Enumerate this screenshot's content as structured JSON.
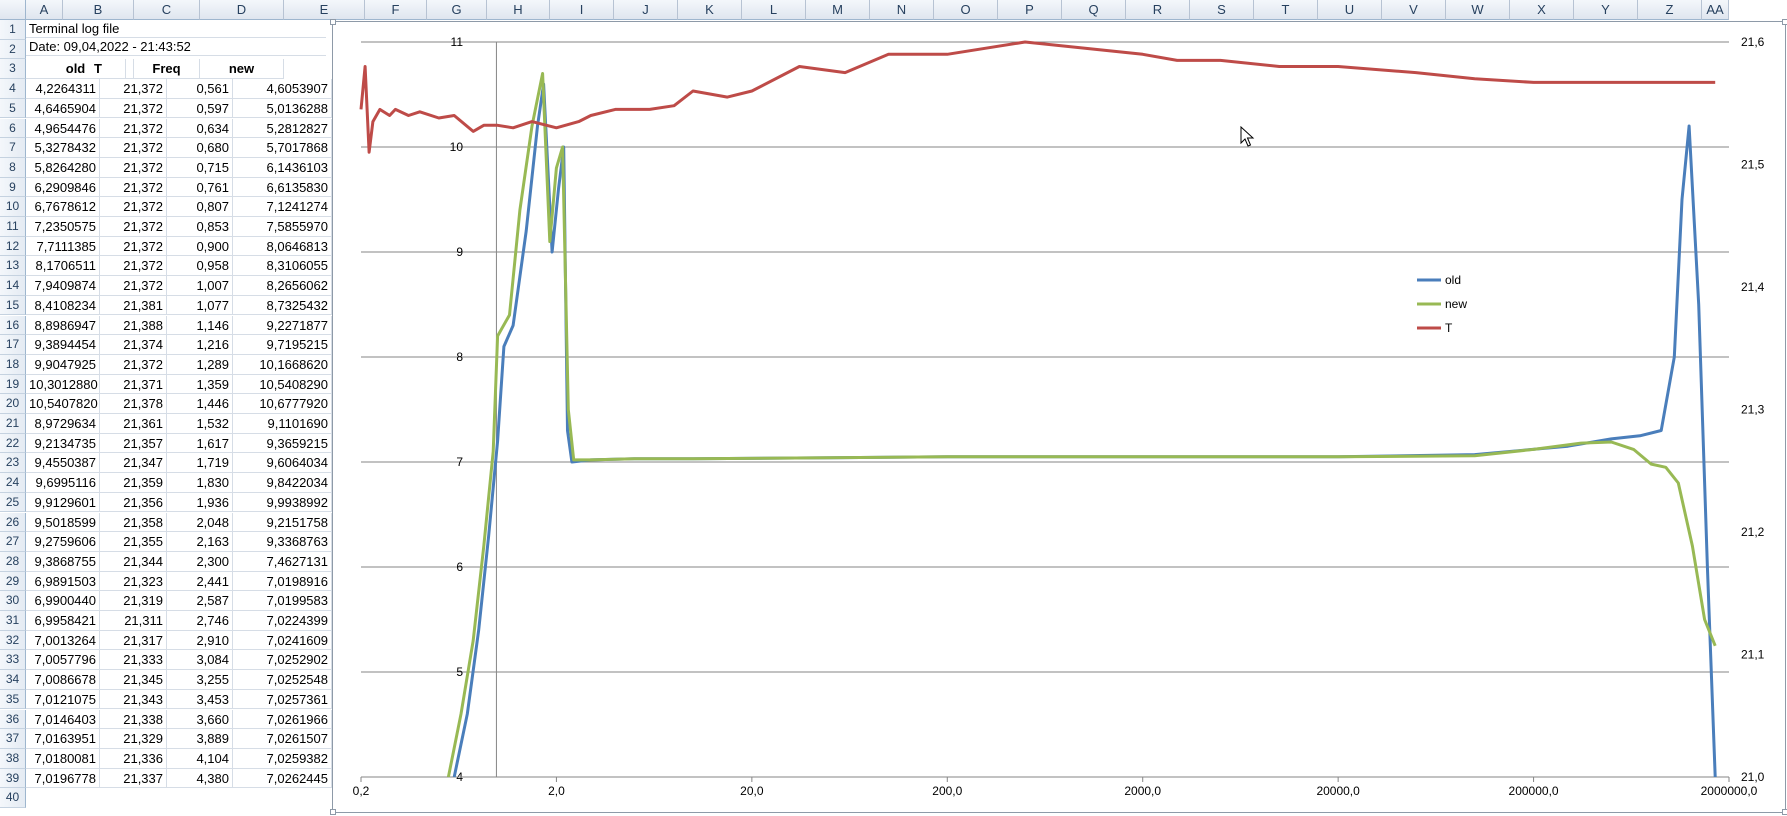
{
  "columns": [
    "A",
    "B",
    "C",
    "D",
    "E",
    "F",
    "G",
    "H",
    "I",
    "J",
    "K",
    "L",
    "M",
    "N",
    "O",
    "P",
    "Q",
    "R",
    "S",
    "T",
    "U",
    "V",
    "W",
    "X",
    "Y",
    "Z",
    "AA"
  ],
  "rows": {
    "r1": "Terminal log file",
    "r2": "Date: 09,04,2022 - 21:43:52",
    "headers": [
      "old",
      "T",
      "Freq",
      "new"
    ],
    "data": [
      [
        "4,2264311",
        "21,372",
        "0,561",
        "4,6053907"
      ],
      [
        "4,6465904",
        "21,372",
        "0,597",
        "5,0136288"
      ],
      [
        "4,9654476",
        "21,372",
        "0,634",
        "5,2812827"
      ],
      [
        "5,3278432",
        "21,372",
        "0,680",
        "5,7017868"
      ],
      [
        "5,8264280",
        "21,372",
        "0,715",
        "6,1436103"
      ],
      [
        "6,2909846",
        "21,372",
        "0,761",
        "6,6135830"
      ],
      [
        "6,7678612",
        "21,372",
        "0,807",
        "7,1241274"
      ],
      [
        "7,2350575",
        "21,372",
        "0,853",
        "7,5855970"
      ],
      [
        "7,7111385",
        "21,372",
        "0,900",
        "8,0646813"
      ],
      [
        "8,1706511",
        "21,372",
        "0,958",
        "8,3106055"
      ],
      [
        "7,9409874",
        "21,372",
        "1,007",
        "8,2656062"
      ],
      [
        "8,4108234",
        "21,381",
        "1,077",
        "8,7325432"
      ],
      [
        "8,8986947",
        "21,388",
        "1,146",
        "9,2271877"
      ],
      [
        "9,3894454",
        "21,374",
        "1,216",
        "9,7195215"
      ],
      [
        "9,9047925",
        "21,372",
        "1,289",
        "10,1668620"
      ],
      [
        "10,3012880",
        "21,371",
        "1,359",
        "10,5408290"
      ],
      [
        "10,5407820",
        "21,378",
        "1,446",
        "10,6777920"
      ],
      [
        "8,9729634",
        "21,361",
        "1,532",
        "9,1101690"
      ],
      [
        "9,2134735",
        "21,357",
        "1,617",
        "9,3659215"
      ],
      [
        "9,4550387",
        "21,347",
        "1,719",
        "9,6064034"
      ],
      [
        "9,6995116",
        "21,359",
        "1,830",
        "9,8422034"
      ],
      [
        "9,9129601",
        "21,356",
        "1,936",
        "9,9938992"
      ],
      [
        "9,5018599",
        "21,358",
        "2,048",
        "9,2151758"
      ],
      [
        "9,2759606",
        "21,355",
        "2,163",
        "9,3368763"
      ],
      [
        "9,3868755",
        "21,344",
        "2,300",
        "7,4627131"
      ],
      [
        "6,9891503",
        "21,323",
        "2,441",
        "7,0198916"
      ],
      [
        "6,9900440",
        "21,319",
        "2,587",
        "7,0199583"
      ],
      [
        "6,9958421",
        "21,311",
        "2,746",
        "7,0224399"
      ],
      [
        "7,0013264",
        "21,317",
        "2,910",
        "7,0241609"
      ],
      [
        "7,0057796",
        "21,333",
        "3,084",
        "7,0252902"
      ],
      [
        "7,0086678",
        "21,345",
        "3,255",
        "7,0252548"
      ],
      [
        "7,0121075",
        "21,343",
        "3,453",
        "7,0257361"
      ],
      [
        "7,0146403",
        "21,338",
        "3,660",
        "7,0261966"
      ],
      [
        "7,0163951",
        "21,329",
        "3,889",
        "7,0261507"
      ],
      [
        "7,0180081",
        "21,336",
        "4,104",
        "7,0259382"
      ],
      [
        "7,0196778",
        "21,337",
        "4,380",
        "7,0262445"
      ]
    ]
  },
  "colors": {
    "old": "#4a7ebb",
    "new": "#98b954",
    "T": "#be4b48"
  },
  "chart_data": {
    "type": "line",
    "x_scale": "log",
    "x_ticks": [
      "0,2",
      "2,0",
      "20,0",
      "200,0",
      "2000,0",
      "20000,0",
      "200000,0",
      "2000000,0"
    ],
    "x_tick_values": [
      0.2,
      2,
      20,
      200,
      2000,
      20000,
      200000,
      2000000
    ],
    "xlim": [
      0.2,
      2000000
    ],
    "y_left_ticks": [
      "4",
      "5",
      "6",
      "7",
      "8",
      "9",
      "10",
      "11"
    ],
    "ylim_left": [
      4,
      11
    ],
    "y_right_ticks": [
      "21,0",
      "21,1",
      "21,2",
      "21,3",
      "21,4",
      "21,5",
      "21,6"
    ],
    "ylim_right": [
      21.0,
      21.6
    ],
    "grid": true,
    "legend_placement": "right",
    "series": [
      {
        "name": "old",
        "axis": "left",
        "x": [
          0.6,
          0.7,
          0.8,
          0.9,
          1.0,
          1.077,
          1.2,
          1.4,
          1.6,
          1.72,
          1.9,
          2.05,
          2.18,
          2.28,
          2.4,
          3,
          5,
          10,
          50,
          200,
          1000,
          5000,
          20000,
          100000,
          300000,
          500000,
          700000,
          900000,
          1050000,
          1150000,
          1250000,
          1400000,
          1550000,
          1700000
        ],
        "y": [
          4.0,
          4.6,
          5.4,
          6.3,
          7.2,
          8.1,
          8.3,
          9.2,
          10.2,
          10.6,
          9.0,
          9.6,
          10.0,
          7.3,
          7.0,
          7.02,
          7.03,
          7.03,
          7.04,
          7.05,
          7.05,
          7.05,
          7.05,
          7.07,
          7.15,
          7.22,
          7.25,
          7.3,
          8.0,
          9.5,
          10.2,
          8.5,
          6.0,
          4.0
        ]
      },
      {
        "name": "new",
        "axis": "left",
        "x": [
          0.56,
          0.65,
          0.75,
          0.85,
          0.95,
          1.0,
          1.15,
          1.3,
          1.5,
          1.7,
          1.85,
          2.0,
          2.15,
          2.3,
          2.45,
          3,
          5,
          10,
          50,
          200,
          1000,
          5000,
          20000,
          100000,
          200000,
          350000,
          500000,
          650000,
          800000,
          950000,
          1100000,
          1300000,
          1500000,
          1700000
        ],
        "y": [
          4.0,
          4.6,
          5.3,
          6.2,
          7.1,
          8.2,
          8.4,
          9.4,
          10.2,
          10.7,
          9.1,
          9.8,
          10.0,
          7.5,
          7.02,
          7.02,
          7.03,
          7.03,
          7.04,
          7.05,
          7.05,
          7.05,
          7.05,
          7.06,
          7.12,
          7.18,
          7.19,
          7.12,
          6.98,
          6.95,
          6.8,
          6.2,
          5.5,
          5.25
        ]
      },
      {
        "name": "T",
        "axis": "right",
        "x": [
          0.2,
          0.21,
          0.22,
          0.23,
          0.25,
          0.28,
          0.3,
          0.35,
          0.4,
          0.5,
          0.6,
          0.75,
          0.85,
          1.0,
          1.2,
          1.5,
          2,
          2.6,
          3,
          4,
          6,
          8,
          10,
          15,
          20,
          35,
          60,
          100,
          200,
          500,
          1000,
          2000,
          3000,
          5000,
          10000,
          20000,
          50000,
          100000,
          200000,
          500000,
          1000000,
          1700000
        ],
        "y": [
          21.545,
          21.58,
          21.51,
          21.535,
          21.545,
          21.54,
          21.545,
          21.54,
          21.543,
          21.538,
          21.54,
          21.527,
          21.532,
          21.532,
          21.53,
          21.535,
          21.53,
          21.535,
          21.54,
          21.545,
          21.545,
          21.548,
          21.56,
          21.555,
          21.56,
          21.58,
          21.575,
          21.59,
          21.59,
          21.6,
          21.595,
          21.59,
          21.585,
          21.585,
          21.58,
          21.58,
          21.575,
          21.57,
          21.567,
          21.567,
          21.567,
          21.567
        ]
      }
    ]
  }
}
